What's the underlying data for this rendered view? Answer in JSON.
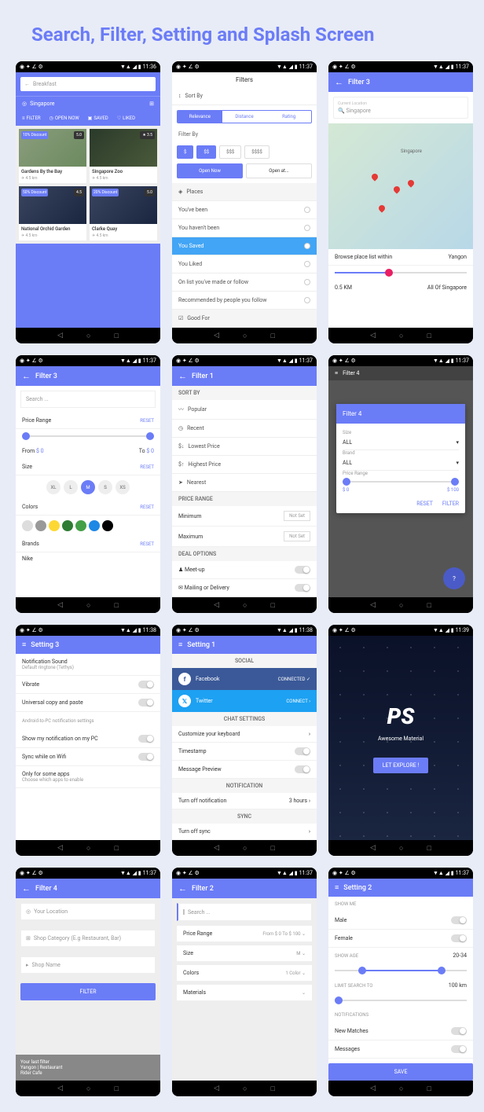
{
  "page_title": "Search, Filter, Setting and Splash Screen",
  "time": "11:36",
  "time2": "11:37",
  "time3": "11:38",
  "time4": "11:39",
  "s1": {
    "search": "Breakfast",
    "loc": "Singapore",
    "tb": [
      "FILTER",
      "OPEN NOW",
      "SAVED",
      "LIKED"
    ],
    "cards": [
      {
        "t": "Gardens By the Bay",
        "d": "4.5 km",
        "b": "10% Discount",
        "r": "5.0"
      },
      {
        "t": "Singapore Zoo",
        "d": "4.5 km",
        "b": "",
        "r": "3.5"
      },
      {
        "t": "National Orchid Garden",
        "d": "4.5 km",
        "b": "50% Discount",
        "r": "4.5"
      },
      {
        "t": "Clarke Quay",
        "d": "4.5 km",
        "b": "20% Discount",
        "r": "5.0"
      }
    ]
  },
  "s2": {
    "title": "Filters",
    "sortby": "Sort By",
    "tabs": [
      "Relevance",
      "Distance",
      "Rating"
    ],
    "filterby": "Filter By",
    "prices": [
      "$",
      "$$",
      "$$$",
      "$$$$"
    ],
    "open": "Open Now",
    "openat": "Open at...",
    "places": "Places",
    "items": [
      "You've been",
      "You haven't been",
      "You Saved",
      "You Liked",
      "On list you've made or follow",
      "Recommended by people you follow"
    ],
    "goodfor": "Good For"
  },
  "s3": {
    "title": "Filter 3",
    "curloc": "Current Location",
    "loc": "Singapore",
    "browse": "Browse place list within",
    "city": "Yangon",
    "min": "0.5 KM",
    "max": "All Of Singapore"
  },
  "s4": {
    "title": "Filter 3",
    "search": "Search ...",
    "pr": "Price Range",
    "reset": "RESET",
    "from": "From",
    "to": "To",
    "v": "$ 0",
    "size": "Size",
    "sizes": [
      "XL",
      "L",
      "M",
      "S",
      "XS"
    ],
    "colors": "Colors",
    "brands": "Brands",
    "brand": "Nike"
  },
  "s5": {
    "title": "Filter 1",
    "sortby": "SORT BY",
    "items": [
      "Popular",
      "Recent",
      "Lowest Price",
      "Highest Price",
      "Nearest"
    ],
    "pr": "PRICE RANGE",
    "min": "Minimum",
    "max": "Maximum",
    "ns": "Not Set",
    "deal": "DEAL OPTIONS",
    "d1": "Meet-up",
    "d2": "Mailing or Delivery"
  },
  "s6": {
    "title": "Filter 4",
    "m": "Filter 4",
    "size": "Size",
    "brand": "Brand",
    "all": "ALL",
    "pr": "Price Range",
    "v1": "$ 0",
    "v2": "$ 100",
    "reset": "RESET",
    "filter": "FILTER"
  },
  "s7": {
    "title": "Setting 3",
    "ns": "Notification Sound",
    "nsd": "Default ringtone (Tethys)",
    "vib": "Vibrate",
    "ucp": "Universal copy and paste",
    "pc": "Android-to-PC notification settings",
    "n1": "Show my notification on my PC",
    "n2": "Sync while on Wifi",
    "only": "Only for some apps",
    "onlyd": "Choose which apps to enable"
  },
  "s8": {
    "title": "Setting 1",
    "social": "SOCIAL",
    "fb": "Facebook",
    "tw": "Twitter",
    "conn": "CONNECTED",
    "conn2": "CONNECT",
    "chat": "CHAT SETTINGS",
    "c1": "Customize your keyboard",
    "c2": "Timestamp",
    "c3": "Message Preview",
    "notif": "NOTIFICATION",
    "n1": "Turn off notification",
    "n1v": "3 hours",
    "sync": "SYNC",
    "s1": "Turn off sync"
  },
  "s9": {
    "logo": "PS",
    "sub": "Awesome Material",
    "btn": "LET EXPLORE !"
  },
  "s10": {
    "title": "Filter 4",
    "f1": "Your Location",
    "f2": "Shop Category (E.g Restaurant, Bar)",
    "f3": "Shop Name",
    "btn": "FILTER",
    "last": "Your last filter",
    "l1": "Yangon | Restaurant",
    "l2": "Rider Cafe"
  },
  "s11": {
    "title": "Filter 2",
    "search": "Search ...",
    "pr": "Price Range",
    "prv": "From $ 0 To $ 100",
    "size": "Size",
    "sv": "M",
    "colors": "Colors",
    "cv": "1 Color",
    "mat": "Materials"
  },
  "s12": {
    "title": "Setting 2",
    "sm": "SHOW ME",
    "m": "Male",
    "f": "Female",
    "sa": "SHOW AGE",
    "sav": "20-34",
    "ls": "LIMIT SEARCH TO",
    "lsv": "100 km",
    "notif": "NOTIFICATIONS",
    "n1": "New Matches",
    "n2": "Messages",
    "save": "SAVE"
  }
}
